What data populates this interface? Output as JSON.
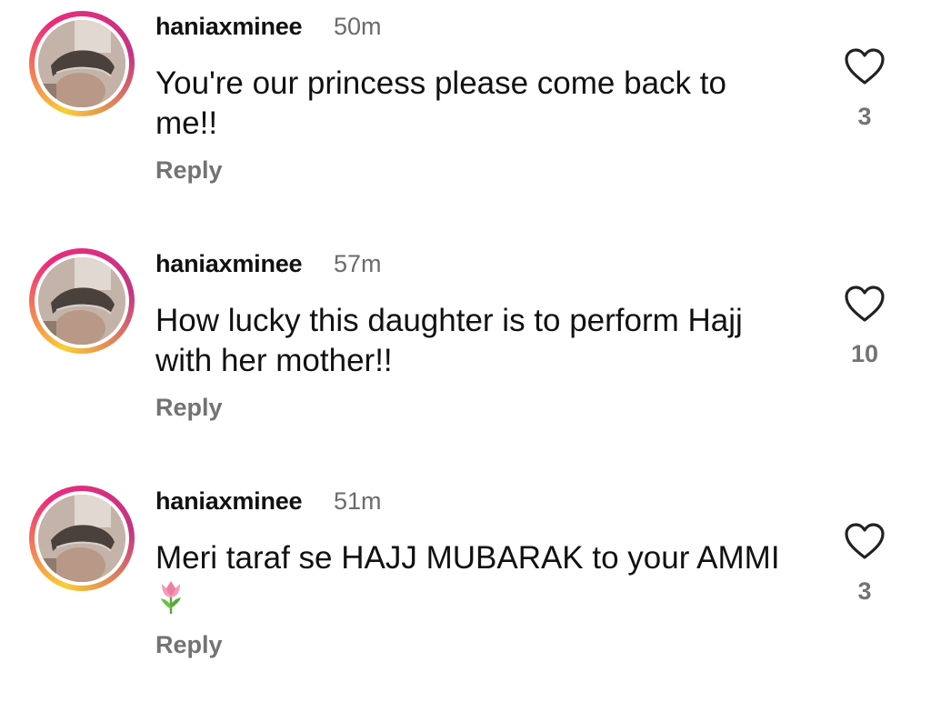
{
  "comments": [
    {
      "username": "haniaxminee",
      "time": "50m",
      "text": "You're our princess please come back to me!!",
      "emoji": "",
      "reply_label": "Reply",
      "likes": "3"
    },
    {
      "username": "haniaxminee",
      "time": "57m",
      "text": "How lucky this daughter is to perform Hajj with her mother!!",
      "emoji": "",
      "reply_label": "Reply",
      "likes": "10"
    },
    {
      "username": "haniaxminee",
      "time": "51m",
      "text": "Meri taraf se HAJJ MUBARAK to your AMMI",
      "emoji": "tulip",
      "reply_label": "Reply",
      "likes": "3"
    }
  ],
  "icons": {
    "like": "heart-outline-icon",
    "emoji": "tulip-icon"
  },
  "colors": {
    "text": "#111111",
    "muted": "#737373",
    "story_ring_start": "#f9ce34",
    "story_ring_mid": "#ee2a7b",
    "story_ring_end": "#c13584"
  }
}
